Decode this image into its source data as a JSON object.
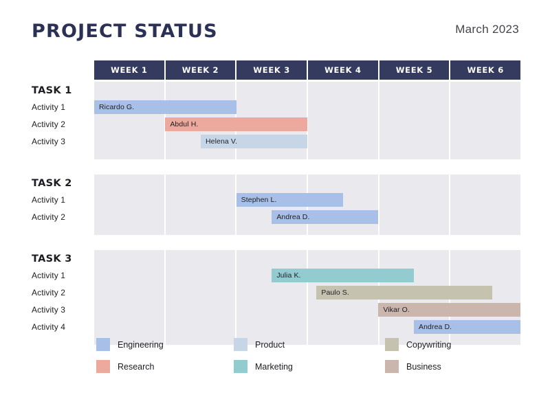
{
  "header": {
    "title": "PROJECT STATUS",
    "date": "March 2023"
  },
  "colors": {
    "title": "#2b3055",
    "header_band": "#353b5e",
    "grid_bg": "#e9e9ee",
    "engineering": "#a8c0e8",
    "research": "#eda99d",
    "product": "#c6d6e6",
    "marketing": "#93ccd0",
    "copywriting": "#c5c3b0",
    "business": "#cbb6ae"
  },
  "chart_data": {
    "type": "bar",
    "chart_subtype": "gantt",
    "title": "PROJECT STATUS",
    "subtitle": "March 2023",
    "xlabel": "",
    "ylabel": "",
    "grid": true,
    "legend_position": "bottom",
    "categories": [
      "WEEK 1",
      "WEEK 2",
      "WEEK 3",
      "WEEK 4",
      "WEEK 5",
      "WEEK 6"
    ],
    "x_axis_units": "weeks",
    "xlim": [
      0,
      6
    ],
    "groups": [
      {
        "name": "TASK 1",
        "rows": [
          {
            "label": "Activity 1",
            "assignee": "Ricardo G.",
            "category": "Engineering",
            "color": "#a8c0e8",
            "start_week": 0.0,
            "end_week": 2.0
          },
          {
            "label": "Activity 2",
            "assignee": "Abdul H.",
            "category": "Research",
            "color": "#eda99d",
            "start_week": 1.0,
            "end_week": 3.0
          },
          {
            "label": "Activity 3",
            "assignee": "Helena V.",
            "category": "Product",
            "color": "#c6d6e6",
            "start_week": 1.5,
            "end_week": 3.0
          }
        ]
      },
      {
        "name": "TASK 2",
        "rows": [
          {
            "label": "Activity 1",
            "assignee": "Stephen L.",
            "category": "Engineering",
            "color": "#a8c0e8",
            "start_week": 2.0,
            "end_week": 3.5
          },
          {
            "label": "Activity 2",
            "assignee": "Andrea D.",
            "category": "Engineering",
            "color": "#a8c0e8",
            "start_week": 2.5,
            "end_week": 4.0
          }
        ]
      },
      {
        "name": "TASK 3",
        "rows": [
          {
            "label": "Activity 1",
            "assignee": "Julia K.",
            "category": "Marketing",
            "color": "#93ccd0",
            "start_week": 2.5,
            "end_week": 4.5
          },
          {
            "label": "Activity 2",
            "assignee": "Paulo S.",
            "category": "Copywriting",
            "color": "#c5c3b0",
            "start_week": 3.13,
            "end_week": 5.6
          },
          {
            "label": "Activity 3",
            "assignee": "Vikar O.",
            "category": "Business",
            "color": "#cbb6ae",
            "start_week": 4.0,
            "end_week": 6.0
          },
          {
            "label": "Activity 4",
            "assignee": "Andrea D.",
            "category": "Engineering",
            "color": "#a8c0e8",
            "start_week": 4.5,
            "end_week": 6.0
          }
        ]
      }
    ],
    "legend": [
      {
        "label": "Engineering",
        "color": "#a8c0e8"
      },
      {
        "label": "Research",
        "color": "#eda99d"
      },
      {
        "label": "Product",
        "color": "#c6d6e6"
      },
      {
        "label": "Marketing",
        "color": "#93ccd0"
      },
      {
        "label": "Copywriting",
        "color": "#c5c3b0"
      },
      {
        "label": "Business",
        "color": "#cbb6ae"
      }
    ]
  }
}
